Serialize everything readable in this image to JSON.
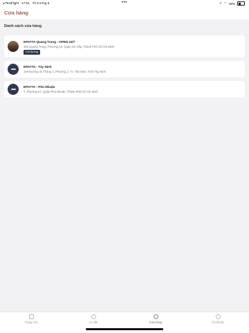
{
  "status_bar": {
    "app": "◂ TestFlight",
    "time": "17:54",
    "date": "Th 6 8 thg 6",
    "battery": "48%",
    "battery_level": 0.48
  },
  "header": {
    "title": "Cửa hàng"
  },
  "section_title": "Danh sách cửa hàng",
  "stores": [
    {
      "name": "EPATTA Quang Trung - OPEN 24/7",
      "address": "393 Quang Trung, Phường 10, Quận Gò Vấp, Thành Phố Hồ Chí Minh",
      "badge": "Chỉ đường"
    },
    {
      "name": "EPATTA - Tây Ninh",
      "address": "149 Đường 30 Tháng 4, Phường 2, Tx. Tây Ninh, Tỉnh Tây Ninh",
      "badge": ""
    },
    {
      "name": "EPATTA - Phú Nhuận",
      "address": "7, Phường 07, Quận Phú Nhuận, Thành Phố Hồ Chí Minh",
      "badge": ""
    }
  ],
  "tabs": [
    {
      "label": "Trang chủ",
      "icon": "home-icon"
    },
    {
      "label": "Ưu đãi",
      "icon": "offer-icon"
    },
    {
      "label": "Cửa hàng",
      "icon": "store-icon",
      "active": true
    },
    {
      "label": "Tài khoản",
      "icon": "account-icon"
    }
  ],
  "colors": {
    "accent": "#a0634a",
    "badge": "#2e3850"
  }
}
